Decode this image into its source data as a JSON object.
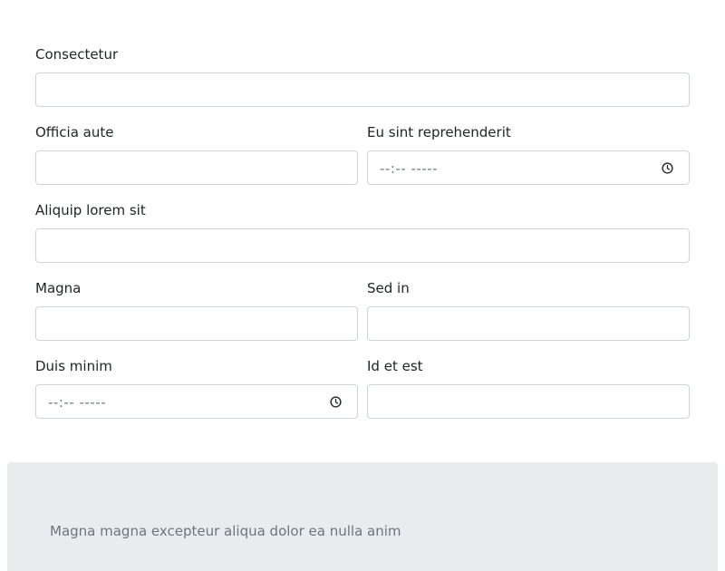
{
  "form": {
    "consectetur": {
      "label": "Consectetur",
      "value": ""
    },
    "officia_aute": {
      "label": "Officia aute",
      "value": ""
    },
    "eu_sint_reprehenderit": {
      "label": "Eu sint reprehenderit",
      "placeholder": "--:-- -----",
      "icon": "clock-icon"
    },
    "aliquip_lorem_sit": {
      "label": "Aliquip lorem sit",
      "value": ""
    },
    "magna": {
      "label": "Magna",
      "value": ""
    },
    "sed_in": {
      "label": "Sed in",
      "value": ""
    },
    "duis_minim": {
      "label": "Duis minim",
      "placeholder": "--:-- -----",
      "icon": "clock-icon"
    },
    "id_et_est": {
      "label": "Id et est",
      "value": ""
    }
  },
  "footer": {
    "text": "Magna magna excepteur aliqua dolor ea nulla anim"
  }
}
